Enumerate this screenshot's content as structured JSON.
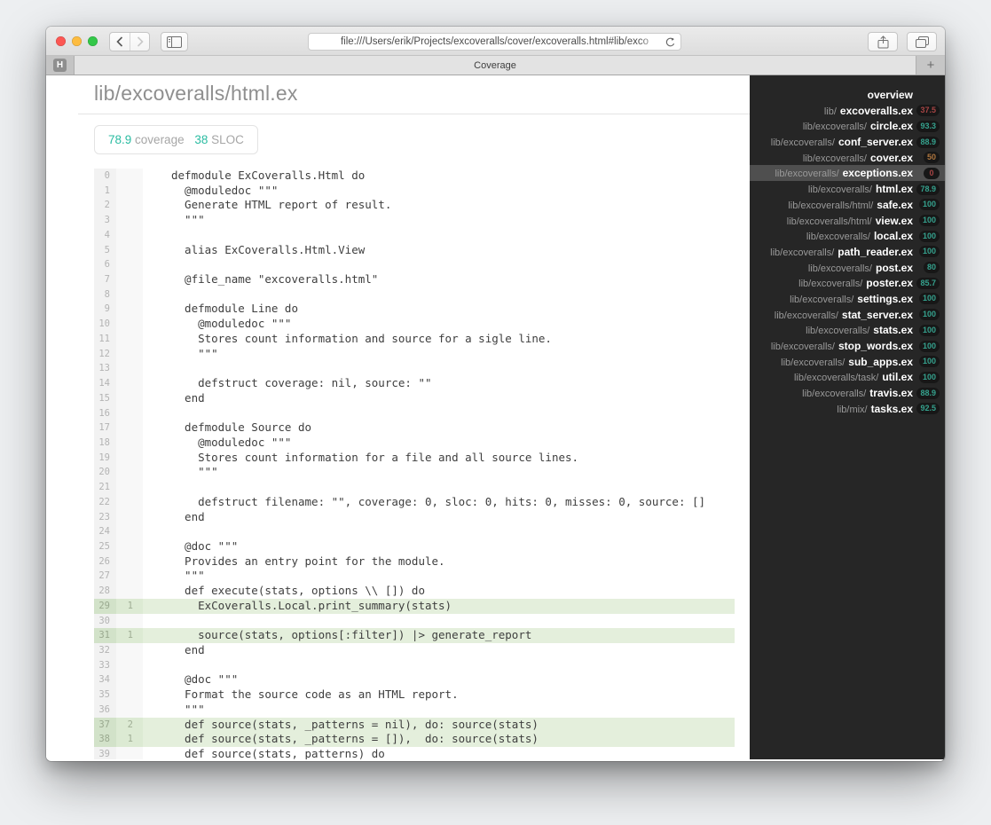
{
  "browser": {
    "url": "file:///Users/erik/Projects/excoveralls/cover/excoveralls.html#lib/exco",
    "pinned_tab_letter": "H",
    "active_tab_title": "Coverage",
    "new_tab_label": "+"
  },
  "header": {
    "title": "lib/excoveralls/html.ex",
    "coverage_value": "78.9",
    "coverage_label": "coverage",
    "sloc_value": "38",
    "sloc_label": "SLOC"
  },
  "code": {
    "lines": [
      {
        "n": "0",
        "hits": "",
        "covered": false,
        "text": "defmodule ExCoveralls.Html do"
      },
      {
        "n": "1",
        "hits": "",
        "covered": false,
        "text": "  @moduledoc \"\"\""
      },
      {
        "n": "2",
        "hits": "",
        "covered": false,
        "text": "  Generate HTML report of result."
      },
      {
        "n": "3",
        "hits": "",
        "covered": false,
        "text": "  \"\"\""
      },
      {
        "n": "4",
        "hits": "",
        "covered": false,
        "text": ""
      },
      {
        "n": "5",
        "hits": "",
        "covered": false,
        "text": "  alias ExCoveralls.Html.View"
      },
      {
        "n": "6",
        "hits": "",
        "covered": false,
        "text": ""
      },
      {
        "n": "7",
        "hits": "",
        "covered": false,
        "text": "  @file_name \"excoveralls.html\""
      },
      {
        "n": "8",
        "hits": "",
        "covered": false,
        "text": ""
      },
      {
        "n": "9",
        "hits": "",
        "covered": false,
        "text": "  defmodule Line do"
      },
      {
        "n": "10",
        "hits": "",
        "covered": false,
        "text": "    @moduledoc \"\"\""
      },
      {
        "n": "11",
        "hits": "",
        "covered": false,
        "text": "    Stores count information and source for a sigle line."
      },
      {
        "n": "12",
        "hits": "",
        "covered": false,
        "text": "    \"\"\""
      },
      {
        "n": "13",
        "hits": "",
        "covered": false,
        "text": ""
      },
      {
        "n": "14",
        "hits": "",
        "covered": false,
        "text": "    defstruct coverage: nil, source: \"\""
      },
      {
        "n": "15",
        "hits": "",
        "covered": false,
        "text": "  end"
      },
      {
        "n": "16",
        "hits": "",
        "covered": false,
        "text": ""
      },
      {
        "n": "17",
        "hits": "",
        "covered": false,
        "text": "  defmodule Source do"
      },
      {
        "n": "18",
        "hits": "",
        "covered": false,
        "text": "    @moduledoc \"\"\""
      },
      {
        "n": "19",
        "hits": "",
        "covered": false,
        "text": "    Stores count information for a file and all source lines."
      },
      {
        "n": "20",
        "hits": "",
        "covered": false,
        "text": "    \"\"\""
      },
      {
        "n": "21",
        "hits": "",
        "covered": false,
        "text": ""
      },
      {
        "n": "22",
        "hits": "",
        "covered": false,
        "text": "    defstruct filename: \"\", coverage: 0, sloc: 0, hits: 0, misses: 0, source: []"
      },
      {
        "n": "23",
        "hits": "",
        "covered": false,
        "text": "  end"
      },
      {
        "n": "24",
        "hits": "",
        "covered": false,
        "text": ""
      },
      {
        "n": "25",
        "hits": "",
        "covered": false,
        "text": "  @doc \"\"\""
      },
      {
        "n": "26",
        "hits": "",
        "covered": false,
        "text": "  Provides an entry point for the module."
      },
      {
        "n": "27",
        "hits": "",
        "covered": false,
        "text": "  \"\"\""
      },
      {
        "n": "28",
        "hits": "",
        "covered": false,
        "text": "  def execute(stats, options \\\\ []) do"
      },
      {
        "n": "29",
        "hits": "1",
        "covered": true,
        "text": "    ExCoveralls.Local.print_summary(stats)"
      },
      {
        "n": "30",
        "hits": "",
        "covered": false,
        "text": ""
      },
      {
        "n": "31",
        "hits": "1",
        "covered": true,
        "text": "    source(stats, options[:filter]) |> generate_report"
      },
      {
        "n": "32",
        "hits": "",
        "covered": false,
        "text": "  end"
      },
      {
        "n": "33",
        "hits": "",
        "covered": false,
        "text": ""
      },
      {
        "n": "34",
        "hits": "",
        "covered": false,
        "text": "  @doc \"\"\""
      },
      {
        "n": "35",
        "hits": "",
        "covered": false,
        "text": "  Format the source code as an HTML report."
      },
      {
        "n": "36",
        "hits": "",
        "covered": false,
        "text": "  \"\"\""
      },
      {
        "n": "37",
        "hits": "2",
        "covered": true,
        "text": "  def source(stats, _patterns = nil), do: source(stats)"
      },
      {
        "n": "38",
        "hits": "1",
        "covered": true,
        "text": "  def source(stats, _patterns = []),  do: source(stats)"
      },
      {
        "n": "39",
        "hits": "",
        "covered": false,
        "text": "  def source(stats, patterns) do"
      }
    ]
  },
  "sidebar": {
    "items": [
      {
        "path": "",
        "file": "overview",
        "pct": null,
        "color": null,
        "highlight": false
      },
      {
        "path": "lib/",
        "file": "excoveralls.ex",
        "pct": "37.5",
        "color": "red",
        "highlight": false
      },
      {
        "path": "lib/excoveralls/",
        "file": "circle.ex",
        "pct": "93.3",
        "color": "teal",
        "highlight": false
      },
      {
        "path": "lib/excoveralls/",
        "file": "conf_server.ex",
        "pct": "88.9",
        "color": "teal",
        "highlight": false
      },
      {
        "path": "lib/excoveralls/",
        "file": "cover.ex",
        "pct": "50",
        "color": "orange",
        "highlight": false
      },
      {
        "path": "lib/excoveralls/",
        "file": "exceptions.ex",
        "pct": "0",
        "color": "red",
        "highlight": true
      },
      {
        "path": "lib/excoveralls/",
        "file": "html.ex",
        "pct": "78.9",
        "color": "teal",
        "highlight": false
      },
      {
        "path": "lib/excoveralls/html/",
        "file": "safe.ex",
        "pct": "100",
        "color": "teal",
        "highlight": false
      },
      {
        "path": "lib/excoveralls/html/",
        "file": "view.ex",
        "pct": "100",
        "color": "teal",
        "highlight": false
      },
      {
        "path": "lib/excoveralls/",
        "file": "local.ex",
        "pct": "100",
        "color": "teal",
        "highlight": false
      },
      {
        "path": "lib/excoveralls/",
        "file": "path_reader.ex",
        "pct": "100",
        "color": "teal",
        "highlight": false
      },
      {
        "path": "lib/excoveralls/",
        "file": "post.ex",
        "pct": "80",
        "color": "teal",
        "highlight": false
      },
      {
        "path": "lib/excoveralls/",
        "file": "poster.ex",
        "pct": "85.7",
        "color": "teal",
        "highlight": false
      },
      {
        "path": "lib/excoveralls/",
        "file": "settings.ex",
        "pct": "100",
        "color": "teal",
        "highlight": false
      },
      {
        "path": "lib/excoveralls/",
        "file": "stat_server.ex",
        "pct": "100",
        "color": "teal",
        "highlight": false
      },
      {
        "path": "lib/excoveralls/",
        "file": "stats.ex",
        "pct": "100",
        "color": "teal",
        "highlight": false
      },
      {
        "path": "lib/excoveralls/",
        "file": "stop_words.ex",
        "pct": "100",
        "color": "teal",
        "highlight": false
      },
      {
        "path": "lib/excoveralls/",
        "file": "sub_apps.ex",
        "pct": "100",
        "color": "teal",
        "highlight": false
      },
      {
        "path": "lib/excoveralls/task/",
        "file": "util.ex",
        "pct": "100",
        "color": "teal",
        "highlight": false
      },
      {
        "path": "lib/excoveralls/",
        "file": "travis.ex",
        "pct": "88.9",
        "color": "teal",
        "highlight": false
      },
      {
        "path": "lib/mix/",
        "file": "tasks.ex",
        "pct": "92.5",
        "color": "teal",
        "highlight": false
      }
    ]
  },
  "colors": {
    "teal": "#2bbca2",
    "teal_dim": "#35a18d",
    "red": "#a64444",
    "orange": "#ae763f",
    "traffic_red": "#fc5753",
    "traffic_yellow": "#fdbc40",
    "traffic_green": "#33c748"
  }
}
